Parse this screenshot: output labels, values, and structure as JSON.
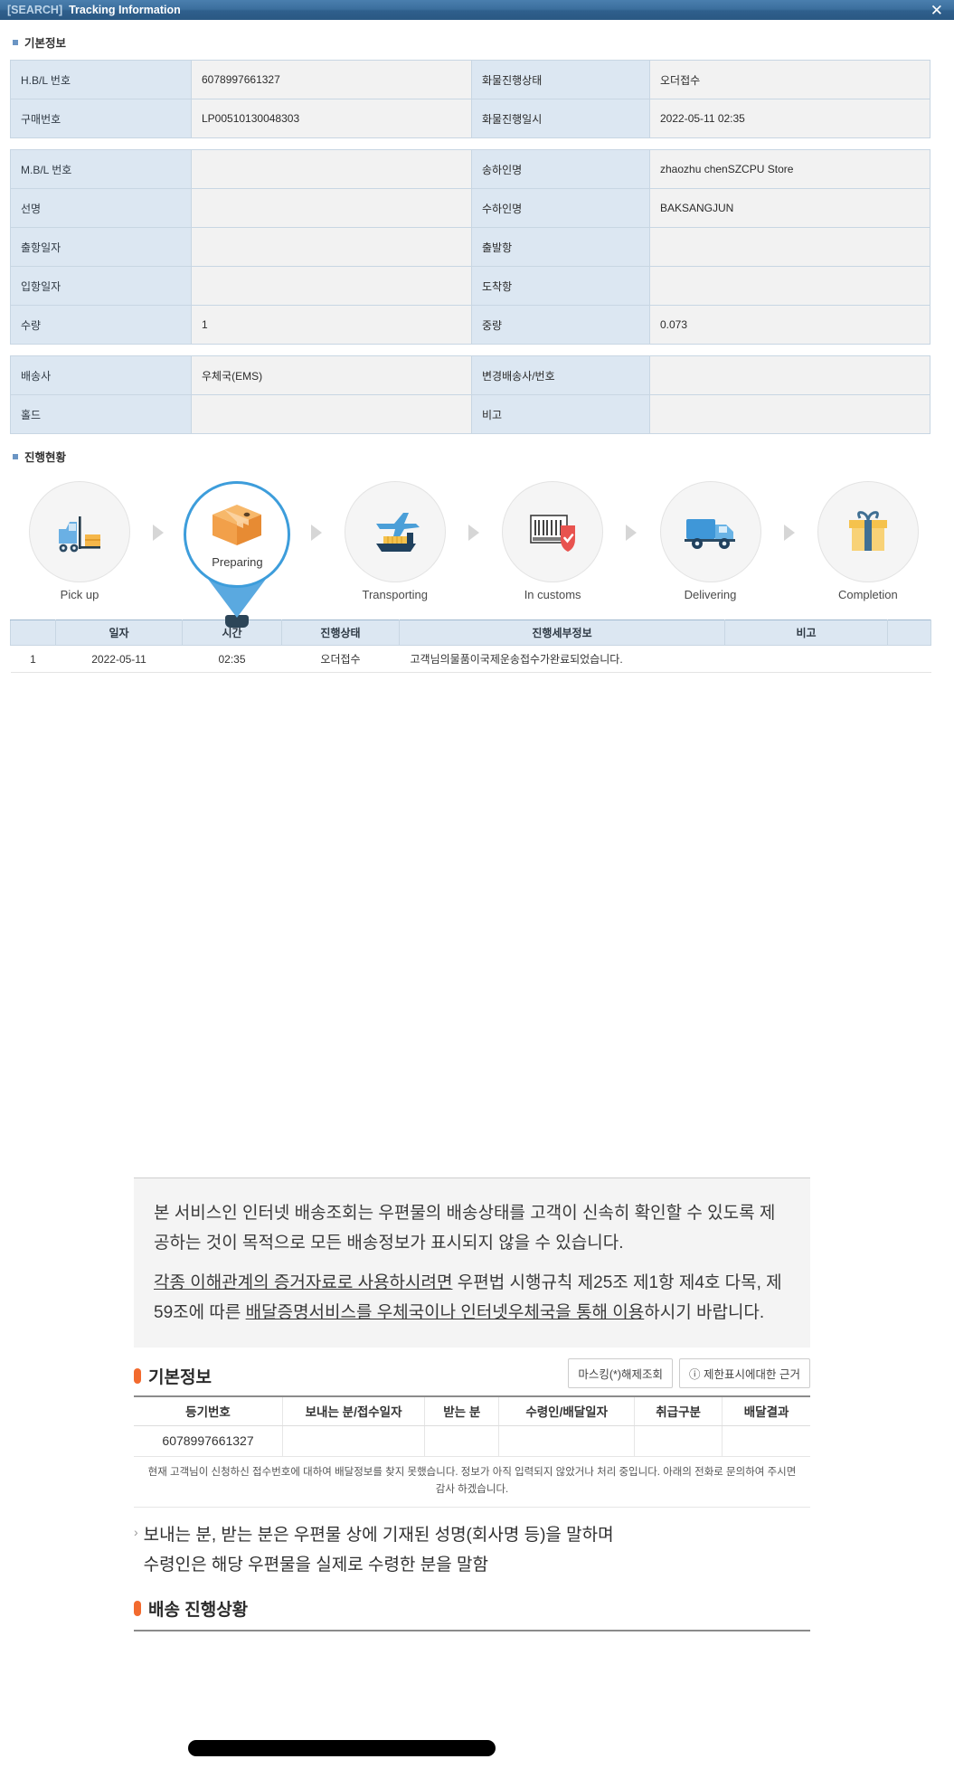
{
  "titlebar": {
    "prefix": "[SEARCH]",
    "title": "Tracking Information",
    "close_icon": "close-icon",
    "close_glyph": "✕"
  },
  "sections": {
    "basic_info_heading": "기본정보",
    "progress_heading": "진행현황"
  },
  "basic_info_block1": [
    {
      "label": "H.B/L 번호",
      "value": "6078997661327",
      "label2": "화물진행상태",
      "value2": "오더접수"
    },
    {
      "label": "구매번호",
      "value": "LP00510130048303",
      "label2": "화물진행일시",
      "value2": "2022-05-11 02:35"
    }
  ],
  "basic_info_block2": [
    {
      "label": "M.B/L 번호",
      "value": "",
      "label2": "송하인명",
      "value2": "zhaozhu chenSZCPU Store"
    },
    {
      "label": "선명",
      "value": "",
      "label2": "수하인명",
      "value2": "BAKSANGJUN"
    },
    {
      "label": "출항일자",
      "value": "",
      "label2": "출발항",
      "value2": ""
    },
    {
      "label": "입항일자",
      "value": "",
      "label2": "도착항",
      "value2": ""
    },
    {
      "label": "수량",
      "value": "1",
      "label2": "중량",
      "value2": "0.073"
    }
  ],
  "basic_info_block3": [
    {
      "label": "배송사",
      "value": "우체국(EMS)",
      "label2": "변경배송사/번호",
      "value2": ""
    },
    {
      "label": "홀드",
      "value": "",
      "label2": "비고",
      "value2": ""
    }
  ],
  "tracker": {
    "steps": [
      {
        "label": "Pick up",
        "icon": "forklift-icon",
        "glyph": "🚜",
        "active": false
      },
      {
        "label": "Preparing",
        "icon": "package-box-icon",
        "glyph": "📦",
        "active": true
      },
      {
        "label": "Transporting",
        "icon": "air-sea-transport-icon",
        "glyph": "✈",
        "active": false
      },
      {
        "label": "In customs",
        "icon": "customs-barcode-shield-icon",
        "glyph": "🛃",
        "active": false
      },
      {
        "label": "Delivering",
        "icon": "delivery-truck-icon",
        "glyph": "🚚",
        "active": false
      },
      {
        "label": "Completion",
        "icon": "gift-box-icon",
        "glyph": "🎁",
        "active": false
      }
    ]
  },
  "history": {
    "columns": [
      "",
      "일자",
      "시간",
      "진행상태",
      "진행세부정보",
      "비고",
      ""
    ],
    "rows": [
      {
        "no": "1",
        "date": "2022-05-11",
        "time": "02:35",
        "status": "오더접수",
        "detail": "고객님의물품이국제운송접수가완료되었습니다.",
        "note": ""
      }
    ]
  },
  "notice": {
    "p1": "본 서비스인 인터넷 배송조회는 우편물의 배송상태를 고객이 신속히 확인할 수 있도록 제공하는 것이 목적으로 모든 배송정보가 표시되지 않을 수 있습니다.",
    "p2_a": "각종 이해관계의 증거자료로 사용하시려면",
    "p2_b": " 우편법 시행규칙 제25조 제1항 제4호 다목, 제59조에 따른 ",
    "p2_c": "배달증명서비스를 우체국이나 인터넷우체국을 통해 이용",
    "p2_d": "하시기 바랍니다."
  },
  "registry": {
    "heading": "기본정보",
    "buttons": [
      {
        "label": "마스킹(*)해제조회",
        "name": "unmask-query-button"
      },
      {
        "label": "ⓘ 제한표시에대한 근거",
        "name": "restriction-basis-button"
      }
    ],
    "columns": [
      "등기번호",
      "보내는 분/접수일자",
      "받는 분",
      "수령인/배달일자",
      "취급구분",
      "배달결과"
    ],
    "row": {
      "reg_no": "6078997661327",
      "sender": "",
      "receiver": "",
      "recipient": "",
      "handling": "",
      "result": ""
    },
    "message": "현재 고객님이 신청하신 접수번호에 대하여 배달정보를 찾지 못했습니다. 정보가 아직 입력되지 않았거나 처리 중입니다. 아래의 전화로 문의하여 주시면 감사 하겠습니다."
  },
  "footnote": {
    "line1": "보내는 분, 받는 분은 우편물 상에 기재된 성명(회사명 등)을 말하며",
    "line2": "수령인은 해당 우편물을 실제로 수령한 분을 말함"
  },
  "delivery_status": {
    "heading": "배송 진행상황"
  }
}
